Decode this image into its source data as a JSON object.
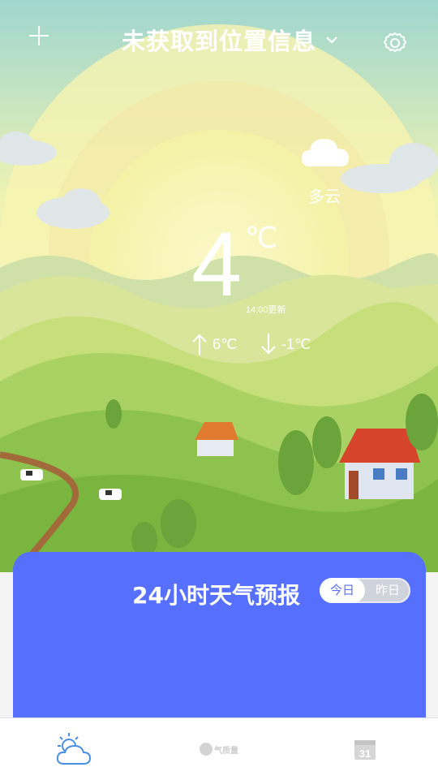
{
  "header": {
    "location_title": "未获取到位置信息",
    "add_icon": "plus-icon",
    "dropdown_icon": "chevron-down-icon",
    "settings_icon": "gear-icon"
  },
  "weather": {
    "condition": "多云",
    "condition_icon": "cloud-icon",
    "temperature": "4",
    "unit": "℃",
    "update_time": "14:00更新",
    "high": "6℃",
    "low": "-1℃"
  },
  "forecast": {
    "title": "24小时天气预报",
    "toggle": {
      "today": "今日",
      "yesterday": "昨日",
      "selected": "今日"
    },
    "accent_color": "#566ffd"
  },
  "bottom_nav": {
    "items": [
      {
        "icon": "weather-icon",
        "active": true
      },
      {
        "icon": "air-quality-icon",
        "label": "气质量",
        "active": false
      },
      {
        "icon": "calendar-icon",
        "label": "31",
        "active": false
      }
    ]
  }
}
